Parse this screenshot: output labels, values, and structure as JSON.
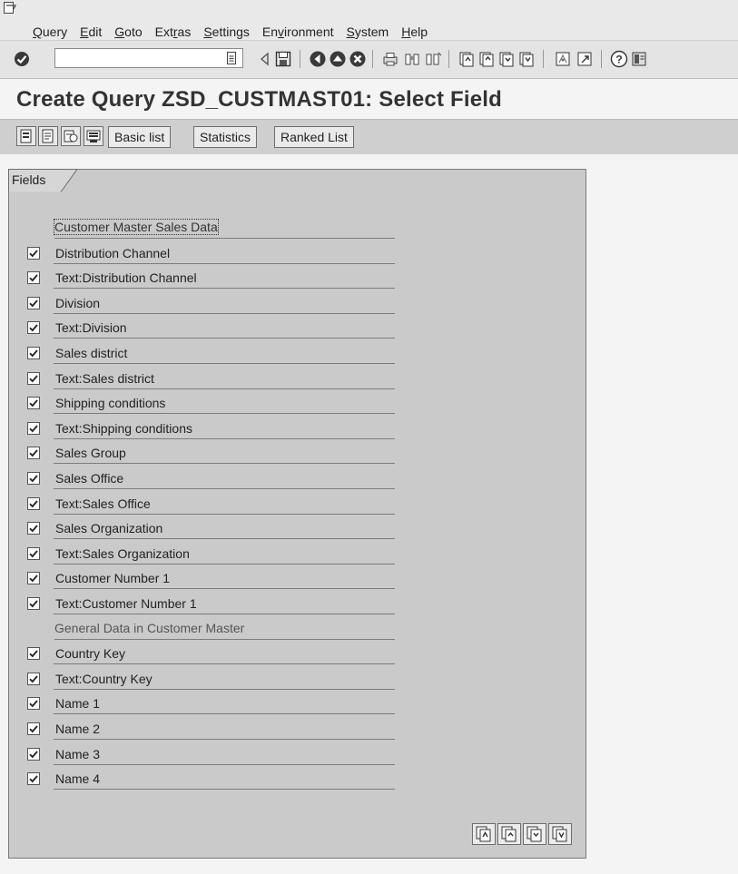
{
  "menu": {
    "items": [
      {
        "pre": "",
        "u": "Q",
        "post": "uery"
      },
      {
        "pre": "",
        "u": "E",
        "post": "dit"
      },
      {
        "pre": "",
        "u": "G",
        "post": "oto"
      },
      {
        "pre": "Ext",
        "u": "r",
        "post": "as"
      },
      {
        "pre": "",
        "u": "S",
        "post": "ettings"
      },
      {
        "pre": "En",
        "u": "v",
        "post": "ironment"
      },
      {
        "pre": "",
        "u": "S",
        "post": "ystem"
      },
      {
        "pre": "",
        "u": "H",
        "post": "elp"
      }
    ]
  },
  "toolbar": {
    "command_value": "",
    "icons": [
      "enter-icon",
      "back-arrow-icon",
      "save-icon",
      "back-icon",
      "exit-icon",
      "cancel-icon",
      "print-icon",
      "find-icon",
      "find-next-icon",
      "first-page-icon",
      "previous-page-icon",
      "next-page-icon",
      "last-page-icon",
      "create-session-icon",
      "shortcut-icon",
      "help-icon",
      "layout-menu-icon"
    ]
  },
  "page": {
    "title": "Create Query ZSD_CUSTMAST01: Select Field"
  },
  "app_toolbar": {
    "buttons": [
      "Basic list",
      "Statistics",
      "Ranked List"
    ]
  },
  "panel": {
    "tab_label": "Fields",
    "group1": "Customer Master Sales Data",
    "group2": "General Data in Customer Master",
    "group1_fields": [
      {
        "label": "Distribution Channel",
        "checked": true
      },
      {
        "label": "Text:Distribution Channel",
        "checked": true
      },
      {
        "label": "Division",
        "checked": true
      },
      {
        "label": "Text:Division",
        "checked": true
      },
      {
        "label": "Sales district",
        "checked": true
      },
      {
        "label": "Text:Sales district",
        "checked": true
      },
      {
        "label": "Shipping conditions",
        "checked": true
      },
      {
        "label": "Text:Shipping conditions",
        "checked": true
      },
      {
        "label": "Sales Group",
        "checked": true
      },
      {
        "label": "Sales Office",
        "checked": true
      },
      {
        "label": "Text:Sales Office",
        "checked": true
      },
      {
        "label": "Sales Organization",
        "checked": true
      },
      {
        "label": "Text:Sales Organization",
        "checked": true
      },
      {
        "label": "Customer Number 1",
        "checked": true
      },
      {
        "label": "Text:Customer Number 1",
        "checked": true
      }
    ],
    "group2_fields": [
      {
        "label": "Country Key",
        "checked": true
      },
      {
        "label": "Text:Country Key",
        "checked": true
      },
      {
        "label": "Name 1",
        "checked": true
      },
      {
        "label": "Name 2",
        "checked": true
      },
      {
        "label": "Name 3",
        "checked": true
      },
      {
        "label": "Name 4",
        "checked": true
      }
    ]
  }
}
